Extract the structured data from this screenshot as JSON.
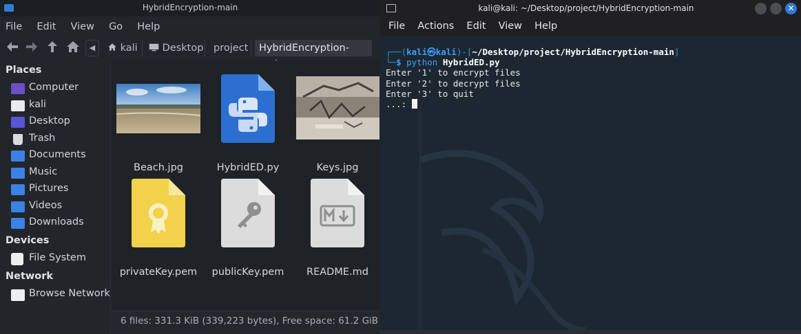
{
  "file_manager": {
    "title": "HybridEncryption-main",
    "menu": [
      "File",
      "Edit",
      "View",
      "Go",
      "Help"
    ],
    "breadcrumbs": [
      "kali",
      "Desktop",
      "project",
      "HybridEncryption-main"
    ],
    "sidebar": {
      "places_header": "Places",
      "places": [
        "Computer",
        "kali",
        "Desktop",
        "Trash",
        "Documents",
        "Music",
        "Pictures",
        "Videos",
        "Downloads"
      ],
      "devices_header": "Devices",
      "devices": [
        "File System"
      ],
      "network_header": "Network",
      "network": [
        "Browse Network"
      ]
    },
    "files": [
      "Beach.jpg",
      "HybridED.py",
      "Keys.jpg",
      "privateKey.pem",
      "publicKey.pem",
      "README.md"
    ],
    "status": "6 files: 331.3 KiB (339,223 bytes), Free space: 61.2 GiB"
  },
  "terminal": {
    "title": "kali@kali: ~/Desktop/project/HybridEncryption-main",
    "menu": [
      "File",
      "Actions",
      "Edit",
      "View",
      "Help"
    ],
    "prompt": {
      "user_host": "kali㉿kali",
      "path": "~/Desktop/project/HybridEncryption-main",
      "cmd": "python",
      "arg": "HybridED.py"
    },
    "output": [
      "Enter '1' to encrypt files",
      "Enter '2' to decrypt files",
      "Enter '3' to quit"
    ],
    "input_prompt": "...: "
  },
  "colors": {
    "accent": "#2f7bd6",
    "prompt_blue": "#3b9fff",
    "terminal_bg": "#1d2732"
  }
}
